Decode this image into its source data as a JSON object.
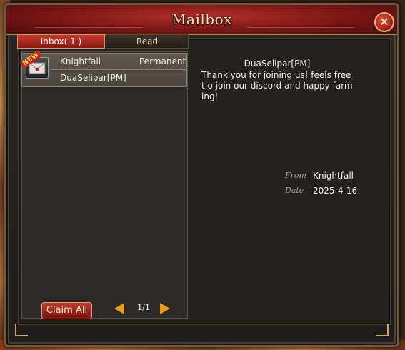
{
  "window": {
    "title": "Mailbox"
  },
  "tabs": {
    "inbox_label": "Inbox(   1 )",
    "read_label": "Read"
  },
  "mail_list": {
    "items": [
      {
        "badge": "NEW",
        "sender": "Knightfall",
        "expiry": "Permanent",
        "subject": "DuaSelipar[PM]",
        "icon": "envelope-icon"
      }
    ]
  },
  "footer": {
    "claim_all_label": "Claim All",
    "page_indicator": "1/1"
  },
  "message": {
    "title": "DuaSelipar[PM]",
    "body": "Thank you for joining us! feels free t o join our discord and happy farming!",
    "from_label": "From",
    "from_value": "Knightfall",
    "date_label": "Date",
    "date_value": "2025-4-16"
  },
  "colors": {
    "accent_red": "#b5302a",
    "gold": "#c9a86a",
    "arrow_orange": "#e89a1a"
  }
}
